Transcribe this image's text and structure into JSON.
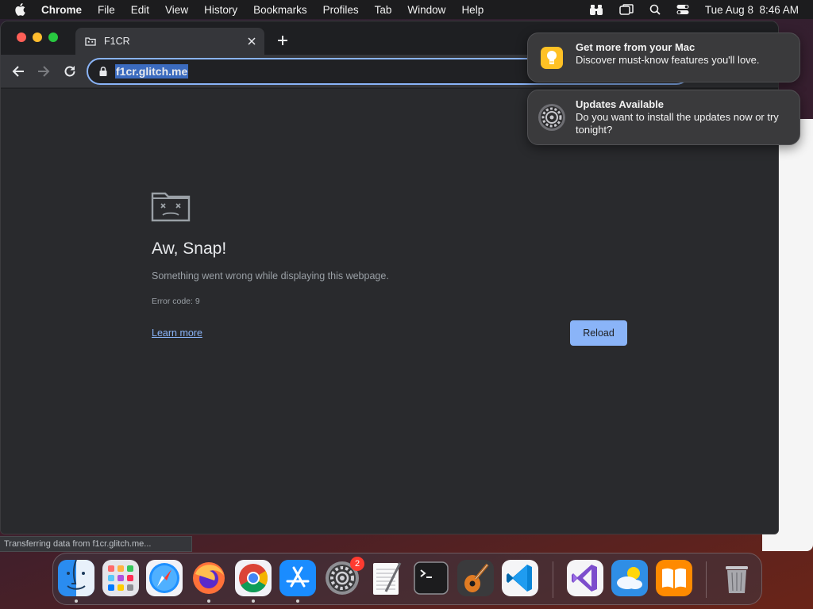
{
  "menubar": {
    "app_name": "Chrome",
    "items": [
      "File",
      "Edit",
      "View",
      "History",
      "Bookmarks",
      "Profiles",
      "Tab",
      "Window",
      "Help"
    ],
    "datetime": "Tue Aug 8  8:46 AM",
    "status_icons": [
      "binoculars-icon",
      "screen-mirror-icon",
      "spotlight-search-icon",
      "control-center-icon"
    ]
  },
  "browser": {
    "tab_title": "F1CR",
    "url": "f1cr.glitch.me",
    "accent": "#8ab4f8"
  },
  "error_page": {
    "title": "Aw, Snap!",
    "message": "Something went wrong while displaying this webpage.",
    "error_code": "Error code: 9",
    "learn_more": "Learn more",
    "reload": "Reload"
  },
  "status_bubble": "Transferring data from f1cr.glitch.me...",
  "notifications": [
    {
      "title": "Get more from your Mac",
      "body": "Discover must-know features you'll love.",
      "icon": "tips-lightbulb-icon"
    },
    {
      "title": "Updates Available",
      "body": "Do you want to install the updates now or try tonight?",
      "icon": "system-settings-gear-icon"
    }
  ],
  "dock": {
    "apps": [
      "Finder",
      "Launchpad",
      "Safari",
      "Firefox",
      "Chrome",
      "App Store",
      "System Settings",
      "TextEdit",
      "Terminal",
      "GarageBand",
      "Visual Studio Code",
      "Visual Studio",
      "Weather",
      "Books",
      "Trash"
    ],
    "system_settings_badge": "2"
  }
}
